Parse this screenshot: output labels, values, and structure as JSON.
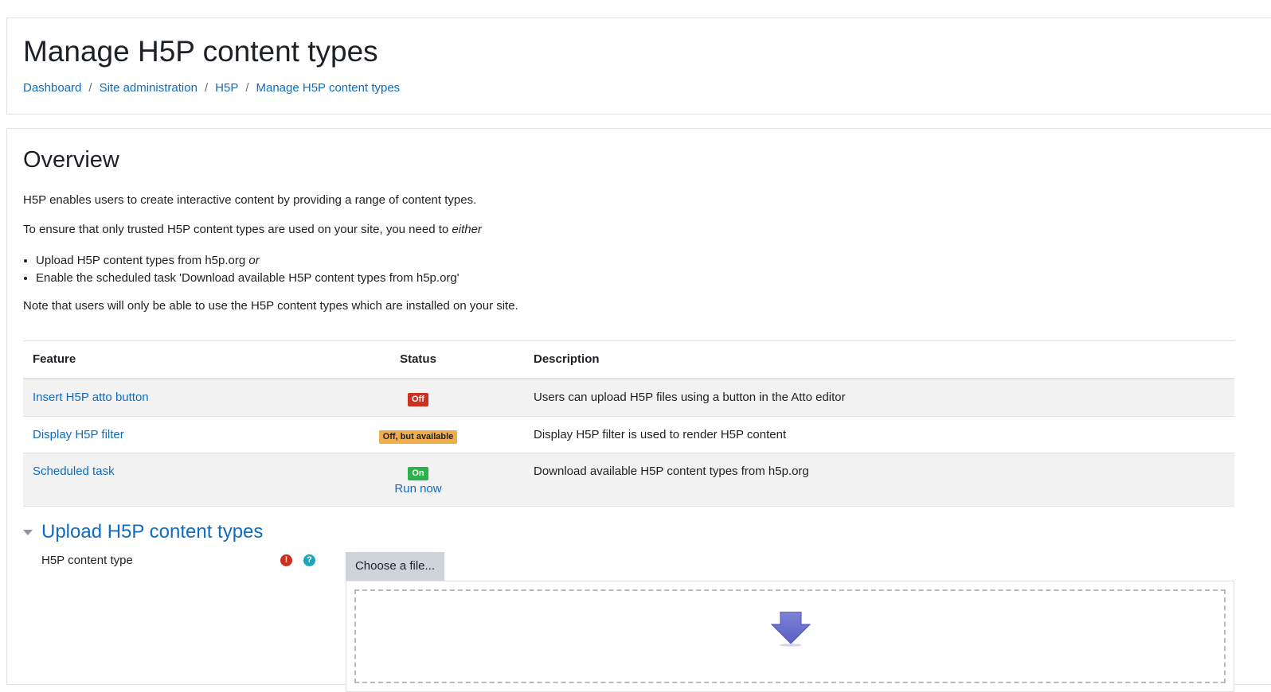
{
  "page": {
    "title": "Manage H5P content types"
  },
  "breadcrumb": [
    {
      "label": "Dashboard"
    },
    {
      "label": "Site administration"
    },
    {
      "label": "H5P"
    },
    {
      "label": "Manage H5P content types"
    }
  ],
  "overview": {
    "heading": "Overview",
    "intro": "H5P enables users to create interactive content by providing a range of content types.",
    "ensure_text": "To ensure that only trusted H5P content types are used on your site, you need to",
    "ensure_emphasis": "either",
    "bullets": [
      {
        "text": "Upload H5P content types from h5p.org",
        "emphasis": "or"
      },
      {
        "text": "Enable the scheduled task 'Download available H5P content types from h5p.org'",
        "emphasis": ""
      }
    ],
    "note": "Note that users will only be able to use the H5P content types which are installed on your site."
  },
  "table": {
    "headers": {
      "feature": "Feature",
      "status": "Status",
      "description": "Description"
    },
    "rows": [
      {
        "feature": "Insert H5P atto button",
        "status": "Off",
        "status_color": "#ca3120",
        "description": "Users can upload H5P files using a button in the Atto editor",
        "action": ""
      },
      {
        "feature": "Display H5P filter",
        "status": "Off, but available",
        "status_color": "#f0ad4e",
        "description": "Display H5P filter is used to render H5P content",
        "action": ""
      },
      {
        "feature": "Scheduled task",
        "status": "On",
        "status_color": "#2cb24a",
        "description": "Download available H5P content types from h5p.org",
        "action": "Run now"
      }
    ]
  },
  "upload": {
    "section_title": "Upload H5P content types",
    "field_label": "H5P content type",
    "required_icon": "!",
    "help_icon": "?",
    "choose_button": "Choose a file..."
  },
  "colors": {
    "link": "#0f6cbf",
    "danger": "#ca3120",
    "warning": "#f0ad4e",
    "success": "#2cb24a",
    "info": "#1aa5c1"
  }
}
